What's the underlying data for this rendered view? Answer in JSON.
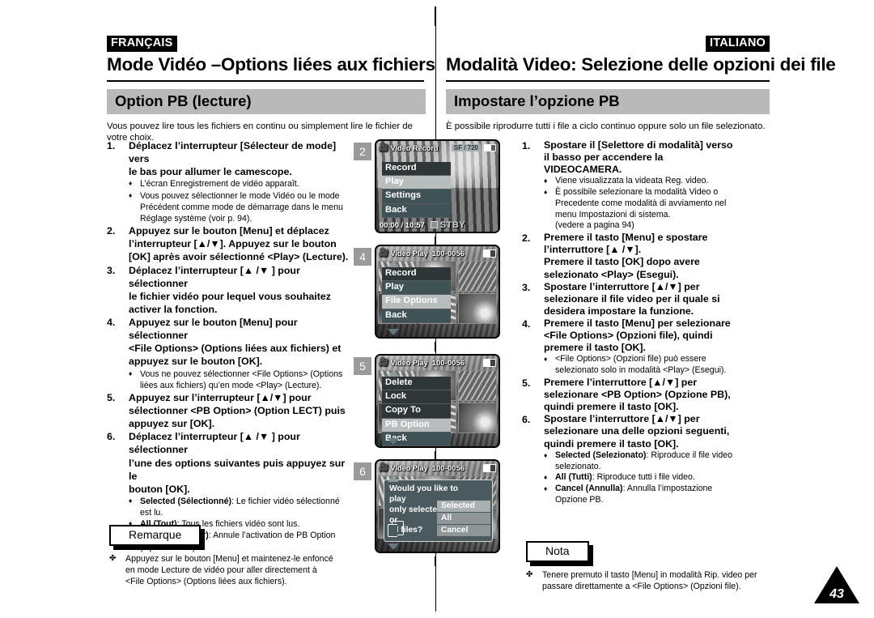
{
  "french": {
    "lang_tag": "FRANÇAIS",
    "page_title": "Mode Vidéo –Options liées aux fichiers",
    "section_title": "Option PB (lecture)",
    "intro": "Vous pouvez lire tous les fichiers en continu ou simplement lire le fichier de votre choix.",
    "steps": [
      {
        "num": "1.",
        "lines": [
          "Déplacez l’interrupteur [Sélecteur de mode] vers",
          "le bas pour allumer le camescope."
        ],
        "bullets": [
          {
            "mark": "♦",
            "lines": [
              "L’écran Enregistrement de vidéo apparaît."
            ]
          },
          {
            "mark": "♦",
            "lines": [
              "Vous pouvez sélectionner le mode Vidéo ou le mode",
              "Précédent comme mode de démarrage dans le menu",
              "Réglage système (voir p. 94)."
            ]
          }
        ]
      },
      {
        "num": "2.",
        "lines": [
          "Appuyez sur le bouton [Menu] et déplacez",
          "l’interrupteur [▲/▼]. Appuyez sur le bouton",
          "[OK] après avoir sélectionné <Play> (Lecture)."
        ],
        "bullets": []
      },
      {
        "num": "3.",
        "lines": [
          "Déplacez l’interrupteur [▲ /▼ ] pour sélectionner",
          "le fichier vidéo pour lequel vous souhaitez",
          "activer la fonction."
        ],
        "bullets": []
      },
      {
        "num": "4.",
        "lines": [
          "Appuyez sur le bouton [Menu] pour sélectionner",
          "<File Options> (Options liées aux fichiers) et",
          "appuyez sur le bouton [OK]."
        ],
        "bullets": [
          {
            "mark": "♦",
            "lines": [
              "Vous ne pouvez sélectionner <File Options> (Options",
              "liées aux fichiers) qu’en mode <Play> (Lecture)."
            ]
          }
        ]
      },
      {
        "num": "5.",
        "lines": [
          " Appuyez sur l’interrupteur [▲/▼] pour",
          "sélectionner <PB Option> (Option LECT) puis",
          "appuyez sur [OK]."
        ],
        "bullets": []
      },
      {
        "num": "6.",
        "lines": [
          "Déplacez l’interrupteur [▲ /▼ ] pour sélectionner",
          "l’une des options suivantes puis appuyez sur le",
          "bouton [OK]."
        ],
        "bullets": [
          {
            "mark": "♦",
            "bold": "Selected (Sélectionné)",
            "lines": [
              ": Le fichier vidéo sélectionné",
              "est lu."
            ]
          },
          {
            "mark": "♦",
            "bold": "All (Tout)",
            "lines": [
              ": Tous les fichiers vidéo sont lus."
            ]
          },
          {
            "mark": "♦",
            "bold": "Cancel (Annuler)",
            "lines": [
              ": Annule l’activation de PB Option",
              "(Option LECT)."
            ]
          }
        ]
      }
    ],
    "note_label": "Remarque",
    "note_mark": "✤",
    "note_lines": [
      "Appuyez sur le bouton [Menu] et maintenez-le enfoncé",
      "en mode Lecture de vidéo pour aller directement à",
      "<File Options> (Options liées aux fichiers)."
    ]
  },
  "italian": {
    "lang_tag": "ITALIANO",
    "page_title": "Modalità Video: Selezione delle opzioni dei file",
    "section_title": "Impostare l’opzione PB",
    "intro": "È possibile riprodurre tutti i file a ciclo continuo oppure solo un file selezionato.",
    "steps": [
      {
        "num": "1.",
        "lines": [
          "Spostare il [Selettore di modalità] verso",
          "il basso per accendere la",
          "VIDEOCAMERA."
        ],
        "bullets": [
          {
            "mark": "♦",
            "lines": [
              "Viene visualizzata la videata Reg. video."
            ]
          },
          {
            "mark": "♦",
            "lines": [
              "È possibile selezionare la modalità Video  o",
              "Precedente come modalità di avviamento nel",
              "menu Impostazioni di sistema.",
              "(vedere a pagina 94)"
            ]
          }
        ]
      },
      {
        "num": "2.",
        "lines": [
          "Premere il tasto [Menu] e spostare",
          "l’interruttore [▲ /▼].",
          "Premere il tasto [OK] dopo avere",
          "selezionato <Play> (Esegui)."
        ],
        "bullets": []
      },
      {
        "num": "3.",
        "lines": [
          "Spostare l’interruttore [▲/▼] per",
          "selezionare il file video per il quale si",
          "desidera impostare la funzione."
        ],
        "bullets": []
      },
      {
        "num": "4.",
        "lines": [
          "Premere il tasto [Menu] per selezionare",
          "<File Options> (Opzioni file), quindi",
          "premere il tasto [OK]."
        ],
        "bullets": [
          {
            "mark": "♦",
            "lines": [
              "<File Options> (Opzioni file) può essere",
              "selezionato solo in modalità <Play> (Esegui)."
            ]
          }
        ]
      },
      {
        "num": "5.",
        "lines": [
          " Premere l’interruttore [▲/▼]  per",
          "selezionare <PB Option> (Opzione PB),",
          "quindi premere il tasto [OK]."
        ],
        "bullets": []
      },
      {
        "num": "6.",
        "lines": [
          "Spostare l’interruttore [▲/▼] per",
          "selezionare una delle opzioni seguenti,",
          "quindi premere il tasto [OK]."
        ],
        "bullets": [
          {
            "mark": "♦",
            "bold": "Selected (Selezionato)",
            "lines": [
              ": Riproduce il file video",
              "selezionato."
            ]
          },
          {
            "mark": "♦",
            "bold": "All (Tutti)",
            "lines": [
              ": Riproduce tutti i file video."
            ]
          },
          {
            "mark": "♦",
            "bold": "Cancel (Annulla)",
            "lines": [
              ": Annulla l’impostazione",
              "Opzione PB."
            ]
          }
        ]
      }
    ],
    "note_label": "Nota",
    "note_mark": "✤",
    "note_lines": [
      "Tenere premuto il tasto [Menu] in modalità Rip. video per",
      "passare direttamente a <File Options> (Opzioni file)."
    ]
  },
  "screenshots": [
    {
      "step": "2",
      "mode": "Video Record",
      "fileno": "",
      "chip": "SF  /  720",
      "timecode": "00:00 / 10:57",
      "status": "STBY",
      "menu": [
        {
          "label": "Record",
          "state": "dark"
        },
        {
          "label": "Play",
          "state": "selected"
        },
        {
          "label": "Settings",
          "state": "teal"
        },
        {
          "label": "Back",
          "state": "teal"
        }
      ]
    },
    {
      "step": "4",
      "mode": "Video Play",
      "fileno": "100-0056",
      "chip": "",
      "timecode": "",
      "status": "",
      "menu": [
        {
          "label": "Record",
          "state": "dark"
        },
        {
          "label": "Play",
          "state": "teal"
        },
        {
          "label": "File Options",
          "state": "selected"
        },
        {
          "label": "Back",
          "state": "teal"
        }
      ]
    },
    {
      "step": "5",
      "mode": "Video Play",
      "fileno": "100-0056",
      "chip": "",
      "timecode": "",
      "status": "",
      "menu": [
        {
          "label": "Delete",
          "state": "dark"
        },
        {
          "label": "Lock",
          "state": "dark"
        },
        {
          "label": "Copy To",
          "state": "dark"
        },
        {
          "label": "PB Option",
          "state": "selected"
        },
        {
          "label": "Back",
          "state": "teal"
        }
      ]
    },
    {
      "step": "6",
      "mode": "Video Play",
      "fileno": "100-0056",
      "chip": "",
      "timecode": "",
      "status": "",
      "dialog": {
        "question_lines": [
          "Would you like to play",
          "only selected file or",
          "all files?"
        ],
        "options": [
          {
            "label": "Selected",
            "state": "highlighted"
          },
          {
            "label": "All",
            "state": "normal"
          },
          {
            "label": "Cancel",
            "state": "normal"
          }
        ]
      }
    }
  ],
  "page_number": "43",
  "colors": {
    "band": "#b9b9b9",
    "step_num_box": "#9a9a9a",
    "lcd_menu_dark": "#2e3638",
    "lcd_menu_teal": "#3f5356",
    "lcd_menu_selected": "#b7bcbc",
    "dialog_bg": "#4a5a5e"
  }
}
